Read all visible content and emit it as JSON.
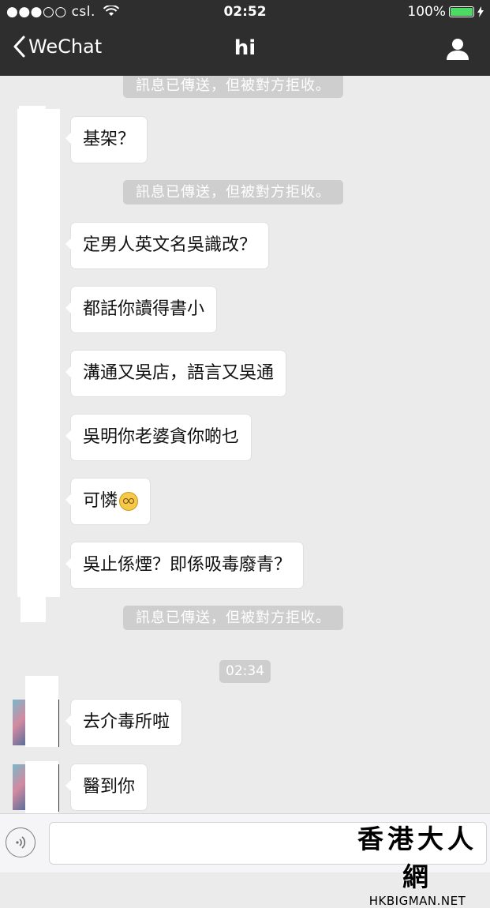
{
  "status_bar": {
    "carrier": "●●●○○ csl.",
    "time": "02:52",
    "battery": "100%"
  },
  "nav": {
    "back_label": "WeChat",
    "title": "hi"
  },
  "system_notice": "訊息已傳送，但被對方拒收。",
  "time_divider": "02:34",
  "messages": [
    "基架？",
    "定男人英文名吳識改？",
    "都話你讀得書小",
    "溝通又吳店，語言又吳通",
    "吳明你老婆貪你啲乜",
    "可憐",
    "吳止係煙？即係吸毒廢青？",
    "去介毒所啦",
    "醫到你"
  ],
  "watermark": {
    "cn": "香港大人網",
    "en": "HKBIGMAN.NET"
  }
}
